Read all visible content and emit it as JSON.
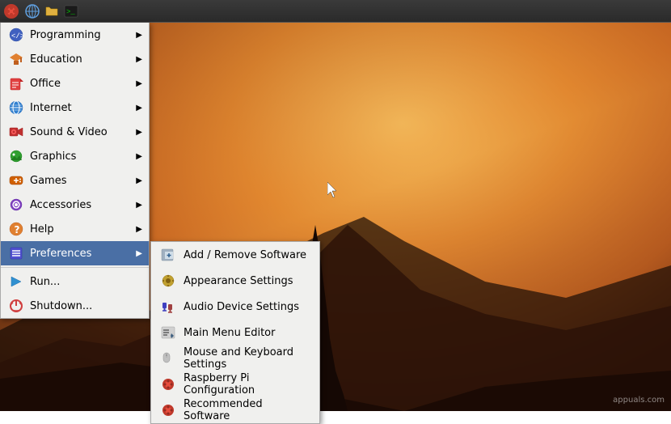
{
  "taskbar": {
    "icons": [
      "raspberry-pi",
      "globe",
      "folder",
      "terminal"
    ]
  },
  "main_menu": {
    "items": [
      {
        "id": "programming",
        "label": "Programming",
        "has_arrow": true,
        "icon": "globe"
      },
      {
        "id": "education",
        "label": "Education",
        "has_arrow": true,
        "icon": "mortarboard"
      },
      {
        "id": "office",
        "label": "Office",
        "has_arrow": true,
        "icon": "office"
      },
      {
        "id": "internet",
        "label": "Internet",
        "has_arrow": true,
        "icon": "internet"
      },
      {
        "id": "sound-video",
        "label": "Sound & Video",
        "has_arrow": true,
        "icon": "sound"
      },
      {
        "id": "graphics",
        "label": "Graphics",
        "has_arrow": true,
        "icon": "graphics"
      },
      {
        "id": "games",
        "label": "Games",
        "has_arrow": true,
        "icon": "games"
      },
      {
        "id": "accessories",
        "label": "Accessories",
        "has_arrow": true,
        "icon": "accessories"
      },
      {
        "id": "help",
        "label": "Help",
        "has_arrow": true,
        "icon": "help"
      },
      {
        "id": "preferences",
        "label": "Preferences",
        "has_arrow": true,
        "icon": "prefs",
        "active": true
      }
    ],
    "bottom_items": [
      {
        "id": "run",
        "label": "Run...",
        "has_arrow": false,
        "icon": "run"
      },
      {
        "id": "shutdown",
        "label": "Shutdown...",
        "has_arrow": false,
        "icon": "shutdown"
      }
    ]
  },
  "sub_menu": {
    "title": "Preferences",
    "items": [
      {
        "id": "add-remove-software",
        "label": "Add / Remove Software",
        "icon": "package"
      },
      {
        "id": "appearance-settings",
        "label": "Appearance Settings",
        "icon": "appearance"
      },
      {
        "id": "audio-device-settings",
        "label": "Audio Device Settings",
        "icon": "audio"
      },
      {
        "id": "main-menu-editor",
        "label": "Main Menu Editor",
        "icon": "menu-editor"
      },
      {
        "id": "mouse-keyboard-settings",
        "label": "Mouse and Keyboard Settings",
        "icon": "mouse-keyboard"
      },
      {
        "id": "raspberry-pi-config",
        "label": "Raspberry Pi Configuration",
        "icon": "raspberry"
      },
      {
        "id": "recommended-software",
        "label": "Recommended Software",
        "icon": "raspberry2"
      }
    ]
  },
  "watermark": "appuals.com"
}
